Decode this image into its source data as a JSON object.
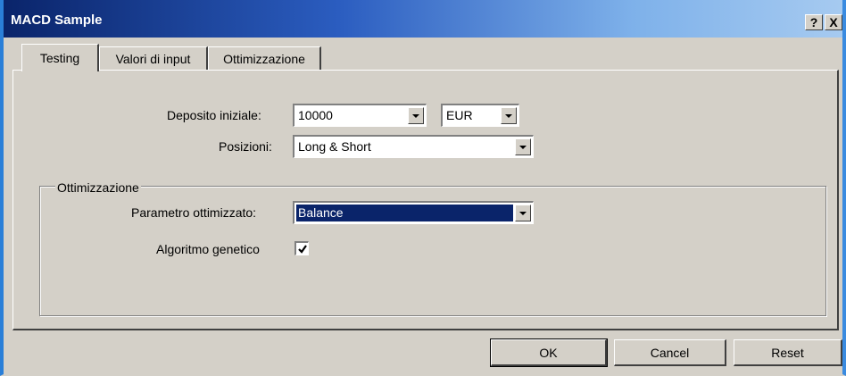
{
  "window": {
    "title": "MACD Sample",
    "help_label": "?",
    "close_label": "X"
  },
  "tabs": [
    {
      "label": "Testing",
      "active": true
    },
    {
      "label": "Valori di input",
      "active": false
    },
    {
      "label": "Ottimizzazione",
      "active": false
    }
  ],
  "testing": {
    "deposit_label": "Deposito iniziale:",
    "deposit_value": "10000",
    "currency_value": "EUR",
    "positions_label": "Posizioni:",
    "positions_value": "Long & Short"
  },
  "optimization": {
    "group_title": "Ottimizzazione",
    "parameter_label": "Parametro ottimizzato:",
    "parameter_value": "Balance",
    "genetic_label": "Algoritmo genetico",
    "genetic_checked": true
  },
  "buttons": {
    "ok": "OK",
    "cancel": "Cancel",
    "reset": "Reset"
  },
  "colors": {
    "titlebar_start": "#0a246a",
    "titlebar_end": "#a6caf0",
    "face": "#d4d0c8",
    "selection": "#0a246a"
  }
}
